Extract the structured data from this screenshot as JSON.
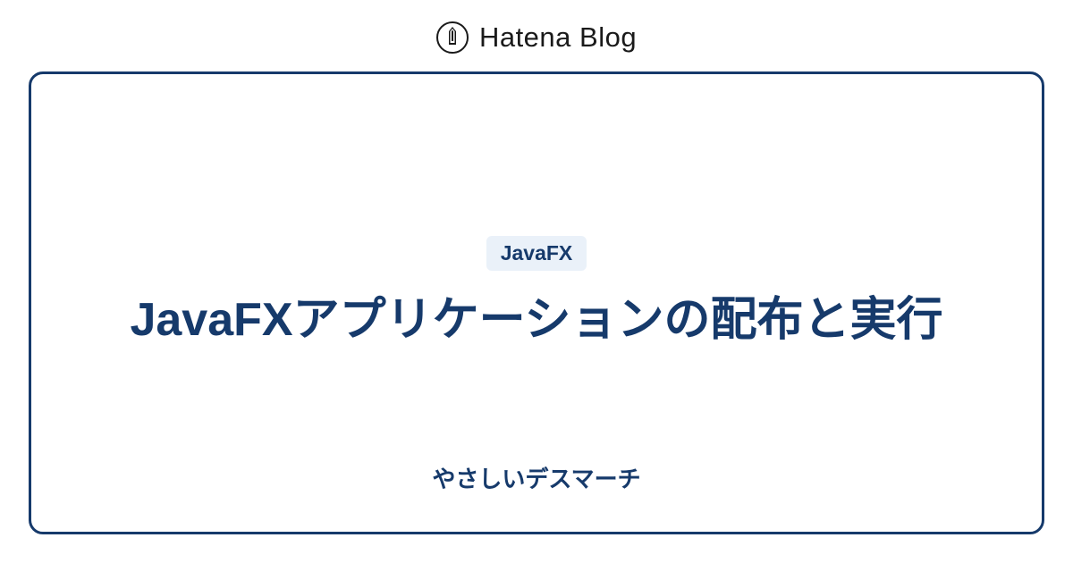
{
  "header": {
    "brand": "Hatena Blog"
  },
  "card": {
    "badge": "JavaFX",
    "title": "JavaFXアプリケーションの配布と実行",
    "subtitle": "やさしいデスマーチ"
  },
  "colors": {
    "accent": "#163a6b",
    "badge_bg": "#eaf1f9"
  }
}
